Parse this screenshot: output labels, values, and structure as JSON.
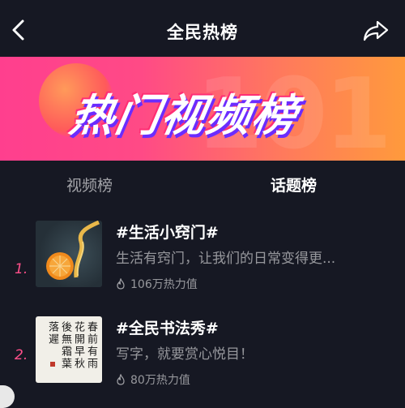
{
  "header": {
    "title": "全民热榜",
    "back_icon": "chevron-left-icon",
    "share_icon": "share-arrow-icon"
  },
  "banner": {
    "text": "热门视频榜",
    "bg_text": "101",
    "colors": {
      "start": "#ff3f8e",
      "end": "#ff9a3c",
      "shadow": "#6b2cff"
    }
  },
  "tabs": [
    {
      "label": "视频榜",
      "active": false
    },
    {
      "label": "话题榜",
      "active": true
    }
  ],
  "list": {
    "items": [
      {
        "rank": "1.",
        "title": "#生活小窍门#",
        "desc": "生活有窍门，让我们的日常变得更...",
        "heat": "106万热力值",
        "thumb": "orange-ribbon-image"
      },
      {
        "rank": "2.",
        "title": "#全民书法秀#",
        "desc": "写字，就要赏心悦目！",
        "heat": "80万热力值",
        "thumb": "calligraphy-image"
      }
    ]
  },
  "accent_color": "#ff4f8a"
}
